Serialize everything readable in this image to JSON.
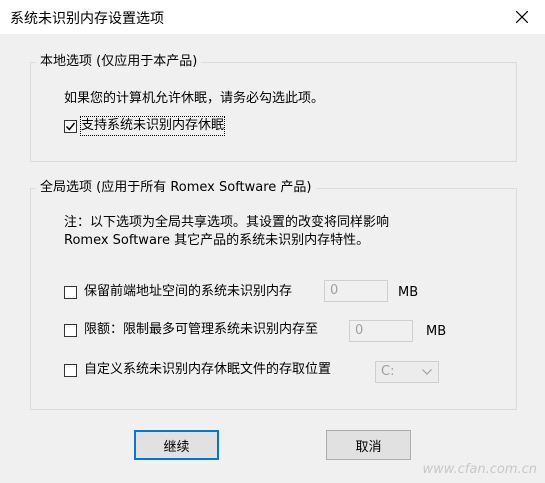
{
  "window": {
    "title": "系统未识别内存设置选项",
    "close_icon": "close-icon"
  },
  "local_group": {
    "title": "本地选项 (仅应用于本产品)",
    "description": "如果您的计算机允许休眠，请务必勾选此项。",
    "hibernate_checkbox": {
      "label": "支持系统未识别内存休眠",
      "checked": true
    }
  },
  "global_group": {
    "title": "全局选项 (应用于所有 Romex Software 产品)",
    "note_line1": "注：以下选项为全局共享选项。其设置的改变将同样影响",
    "note_line2": "Romex Software 其它产品的系统未识别内存特性。",
    "reserve_option": {
      "label": "保留前端地址空间的系统未识别内存",
      "checked": false,
      "value": "0",
      "unit": "MB"
    },
    "limit_option": {
      "label": "限额：限制最多可管理系统未识别内存至",
      "checked": false,
      "value": "0",
      "unit": "MB"
    },
    "location_option": {
      "label": "自定义系统未识别内存休眠文件的存取位置",
      "checked": false,
      "drive": "C:"
    }
  },
  "buttons": {
    "continue": "继续",
    "cancel": "取消"
  },
  "watermark": "www.cfan.com.cn"
}
